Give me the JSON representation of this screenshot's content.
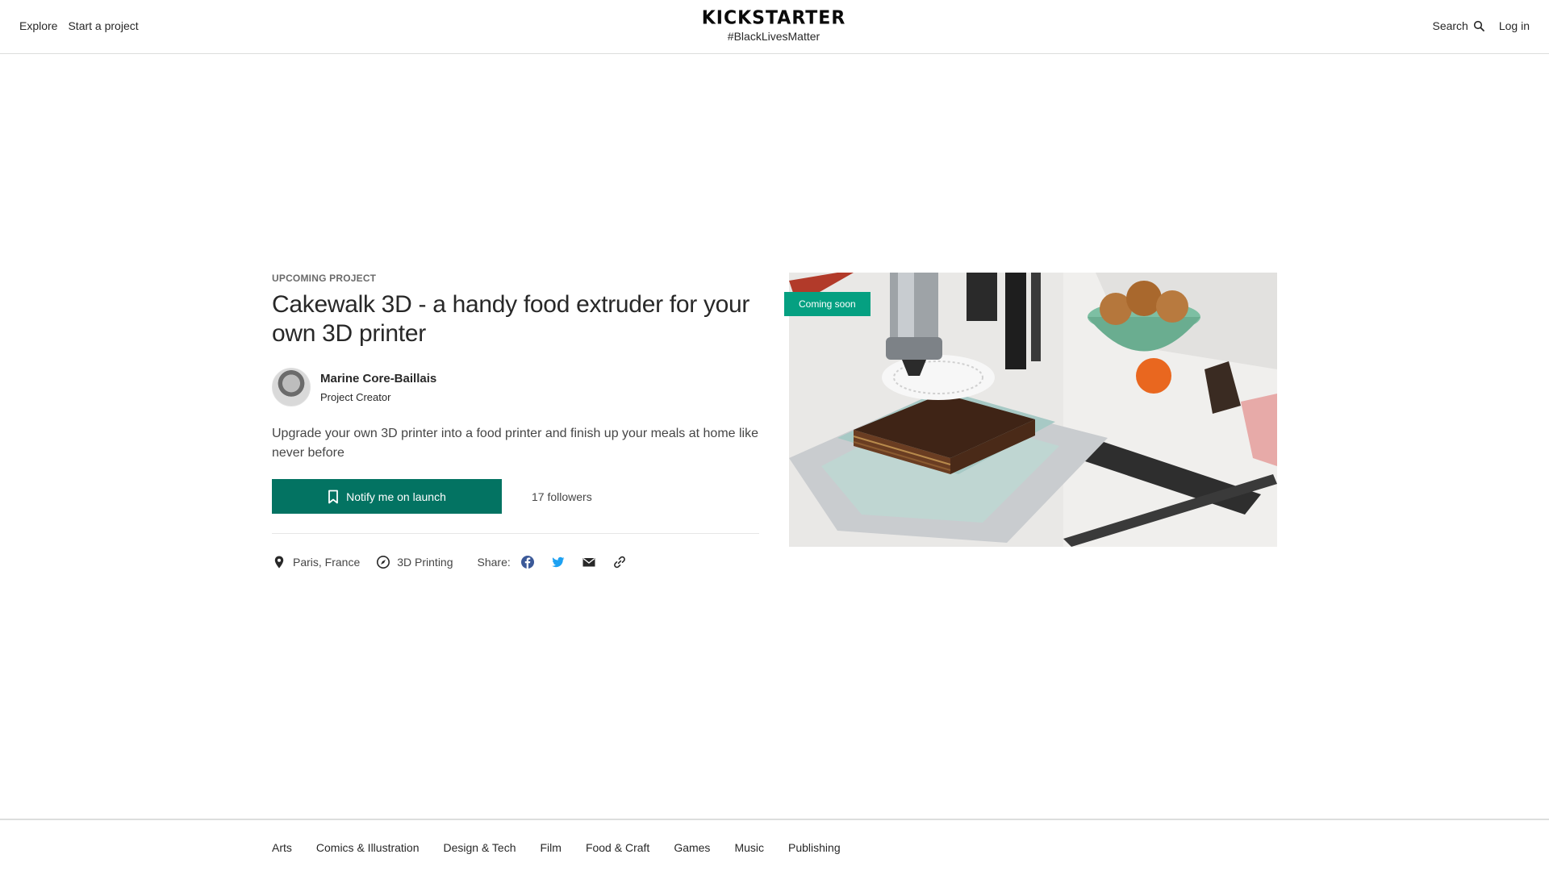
{
  "header": {
    "nav_left": [
      "Explore",
      "Start a project"
    ],
    "logo": "KICKSTARTER",
    "tagline": "#BlackLivesMatter",
    "search_label": "Search",
    "login_label": "Log in"
  },
  "project": {
    "eyebrow": "UPCOMING PROJECT",
    "title": "Cakewalk 3D - a handy food extruder for your own 3D printer",
    "creator_name": "Marine Core-Baillais",
    "creator_role": "Project Creator",
    "blurb": "Upgrade your own 3D printer into a food printer and finish up your meals at home like never before",
    "notify_label": "Notify me on launch",
    "followers": "17 followers",
    "location": "Paris, France",
    "category": "3D Printing",
    "share_label": "Share:",
    "badge": "Coming soon"
  },
  "icons": {
    "search": "search-icon",
    "bookmark": "bookmark-icon",
    "location": "location-pin-icon",
    "category": "compass-icon",
    "facebook": "facebook-icon",
    "twitter": "twitter-icon",
    "email": "email-icon",
    "link": "link-icon"
  },
  "colors": {
    "primary_green": "#037362",
    "badge_green": "#05a081",
    "facebook": "#3b5998",
    "twitter": "#1da1f2"
  },
  "footer": {
    "categories": [
      "Arts",
      "Comics & Illustration",
      "Design & Tech",
      "Film",
      "Food & Craft",
      "Games",
      "Music",
      "Publishing"
    ]
  }
}
